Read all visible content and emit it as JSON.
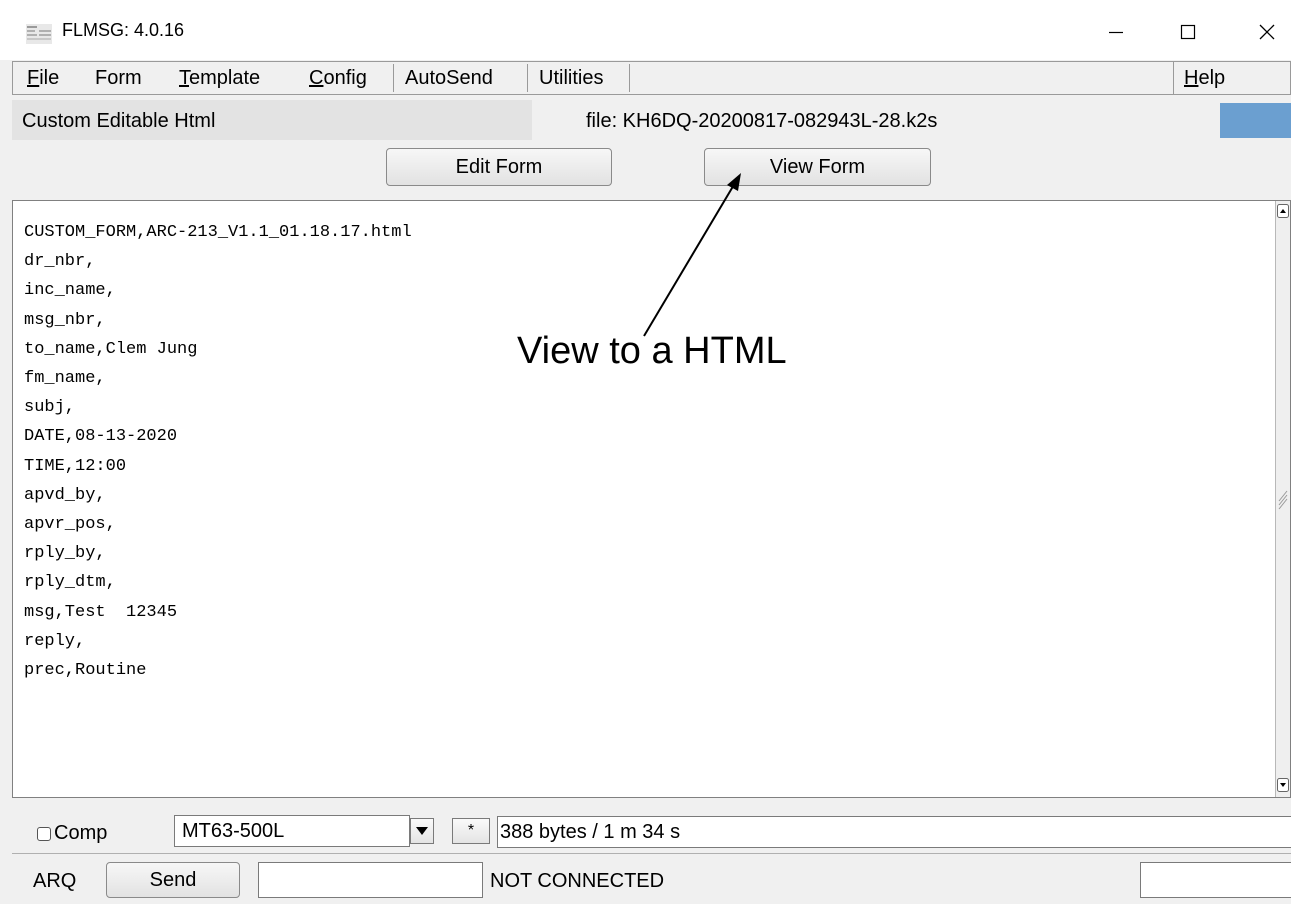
{
  "window": {
    "title": "FLMSG: 4.0.16",
    "controls": {
      "minimize": "minimize",
      "maximize": "maximize",
      "close": "close"
    }
  },
  "menu": {
    "items": [
      {
        "label": "File",
        "underline": "F",
        "rest": "ile"
      },
      {
        "label": "Form",
        "underline": "F",
        "rest": "orm"
      },
      {
        "label": "Template",
        "underline": "T",
        "rest": "emplate"
      },
      {
        "label": "Config",
        "underline": "C",
        "rest": "onfig"
      },
      {
        "label": "AutoSend",
        "underline": "",
        "rest": "AutoSend"
      },
      {
        "label": "Utilities",
        "underline": "",
        "rest": "Utilities"
      }
    ],
    "help": {
      "label": "Help",
      "underline": "H",
      "rest": "elp"
    }
  },
  "info": {
    "form_type": "Custom Editable Html",
    "file": "file: KH6DQ-20200817-082943L-28.k2s"
  },
  "buttons": {
    "edit_form": "Edit Form",
    "view_form": "View Form"
  },
  "editor": {
    "lines": [
      "CUSTOM_FORM,ARC-213_V1.1_01.18.17.html",
      "dr_nbr,",
      "inc_name,",
      "msg_nbr,",
      "to_name,Clem Jung",
      "fm_name,",
      "subj,",
      "DATE,08-13-2020",
      "TIME,12:00",
      "apvd_by,",
      "apvr_pos,",
      "rply_by,",
      "rply_dtm,",
      "msg,Test  12345",
      "reply,",
      "prec,Routine"
    ]
  },
  "annotation": {
    "text": "View to a HTML"
  },
  "bottom": {
    "comp_label": "Comp",
    "comp_checked": false,
    "mode": "MT63-500L",
    "star_label": "*",
    "transfer_info": "388 bytes / 1 m 34 s",
    "arq_label": "ARQ",
    "send_label": "Send",
    "send_field": "",
    "status": "NOT CONNECTED",
    "right_field": ""
  },
  "colors": {
    "window_bg": "#f0f0f0",
    "accent_box": "#6b9fd0",
    "editor_bg": "#ffffff"
  }
}
